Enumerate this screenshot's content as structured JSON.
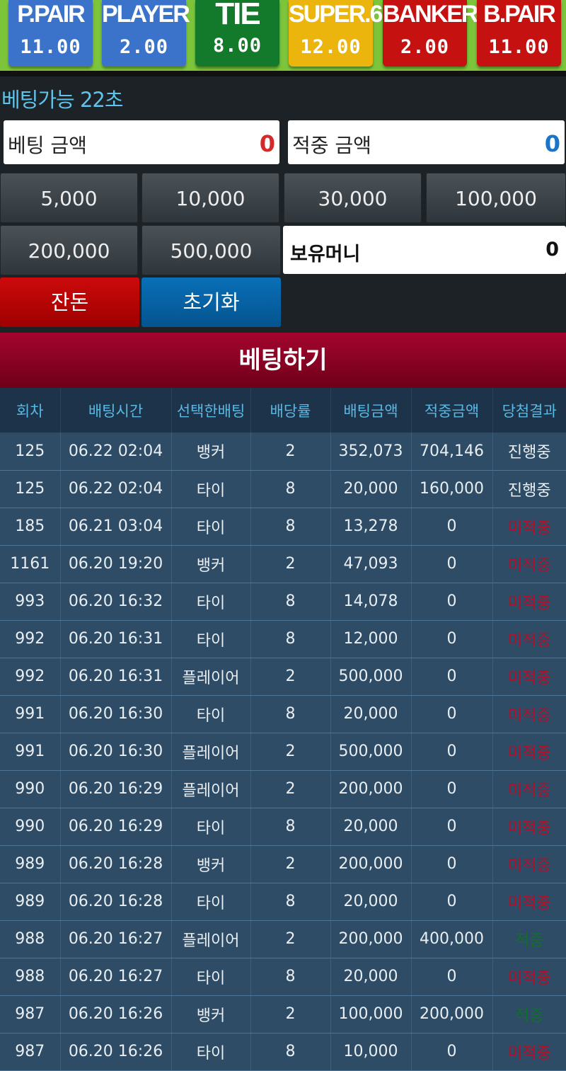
{
  "bet_options": [
    {
      "name": "P.PAIR",
      "odds": "11.00",
      "color": "#3a73c9"
    },
    {
      "name": "PLAYER",
      "odds": "2.00",
      "color": "#3a73c9"
    },
    {
      "name": "TIE",
      "odds": "8.00",
      "color": "#137a2c"
    },
    {
      "name": "SUPER.6",
      "odds": "12.00",
      "color": "#ebb50e"
    },
    {
      "name": "BANKER",
      "odds": "2.00",
      "color": "#c61111"
    },
    {
      "name": "B.PAIR",
      "odds": "11.00",
      "color": "#c61111"
    }
  ],
  "timer_text": "베팅가능 22초",
  "bet_amount": {
    "label": "베팅 금액",
    "value": "0",
    "color": "#d42a2a"
  },
  "win_amount": {
    "label": "적중 금액",
    "value": "0",
    "color": "#1a74c9"
  },
  "chips": [
    "5,000",
    "10,000",
    "30,000",
    "100,000",
    "200,000",
    "500,000"
  ],
  "money": {
    "label": "보유머니",
    "value": "0"
  },
  "balance_button": "잔돈",
  "reset_button": "초기화",
  "place_bet_button": "베팅하기",
  "history": {
    "columns": [
      "회차",
      "배팅시간",
      "선택한배팅",
      "배당률",
      "배팅금액",
      "적중금액",
      "당첨결과"
    ],
    "rows": [
      {
        "round": "125",
        "time": "06.22 02:04",
        "choice": "뱅커",
        "odds": "2",
        "bet": "352,073",
        "win": "704,146",
        "result": "진행중",
        "status": "pending"
      },
      {
        "round": "125",
        "time": "06.22 02:04",
        "choice": "타이",
        "odds": "8",
        "bet": "20,000",
        "win": "160,000",
        "result": "진행중",
        "status": "pending"
      },
      {
        "round": "185",
        "time": "06.21 03:04",
        "choice": "타이",
        "odds": "8",
        "bet": "13,278",
        "win": "0",
        "result": "미적중",
        "status": "lose"
      },
      {
        "round": "1161",
        "time": "06.20 19:20",
        "choice": "뱅커",
        "odds": "2",
        "bet": "47,093",
        "win": "0",
        "result": "미적중",
        "status": "lose"
      },
      {
        "round": "993",
        "time": "06.20 16:32",
        "choice": "타이",
        "odds": "8",
        "bet": "14,078",
        "win": "0",
        "result": "미적중",
        "status": "lose"
      },
      {
        "round": "992",
        "time": "06.20 16:31",
        "choice": "타이",
        "odds": "8",
        "bet": "12,000",
        "win": "0",
        "result": "미적중",
        "status": "lose"
      },
      {
        "round": "992",
        "time": "06.20 16:31",
        "choice": "플레이어",
        "odds": "2",
        "bet": "500,000",
        "win": "0",
        "result": "미적중",
        "status": "lose"
      },
      {
        "round": "991",
        "time": "06.20 16:30",
        "choice": "타이",
        "odds": "8",
        "bet": "20,000",
        "win": "0",
        "result": "미적중",
        "status": "lose"
      },
      {
        "round": "991",
        "time": "06.20 16:30",
        "choice": "플레이어",
        "odds": "2",
        "bet": "500,000",
        "win": "0",
        "result": "미적중",
        "status": "lose"
      },
      {
        "round": "990",
        "time": "06.20 16:29",
        "choice": "플레이어",
        "odds": "2",
        "bet": "200,000",
        "win": "0",
        "result": "미적중",
        "status": "lose"
      },
      {
        "round": "990",
        "time": "06.20 16:29",
        "choice": "타이",
        "odds": "8",
        "bet": "20,000",
        "win": "0",
        "result": "미적중",
        "status": "lose"
      },
      {
        "round": "989",
        "time": "06.20 16:28",
        "choice": "뱅커",
        "odds": "2",
        "bet": "200,000",
        "win": "0",
        "result": "미적중",
        "status": "lose"
      },
      {
        "round": "989",
        "time": "06.20 16:28",
        "choice": "타이",
        "odds": "8",
        "bet": "20,000",
        "win": "0",
        "result": "미적중",
        "status": "lose"
      },
      {
        "round": "988",
        "time": "06.20 16:27",
        "choice": "플레이어",
        "odds": "2",
        "bet": "200,000",
        "win": "400,000",
        "result": "적중",
        "status": "win"
      },
      {
        "round": "988",
        "time": "06.20 16:27",
        "choice": "타이",
        "odds": "8",
        "bet": "20,000",
        "win": "0",
        "result": "미적중",
        "status": "lose"
      },
      {
        "round": "987",
        "time": "06.20 16:26",
        "choice": "뱅커",
        "odds": "2",
        "bet": "100,000",
        "win": "200,000",
        "result": "적중",
        "status": "win"
      },
      {
        "round": "987",
        "time": "06.20 16:26",
        "choice": "타이",
        "odds": "8",
        "bet": "10,000",
        "win": "0",
        "result": "미적중",
        "status": "lose"
      }
    ]
  }
}
